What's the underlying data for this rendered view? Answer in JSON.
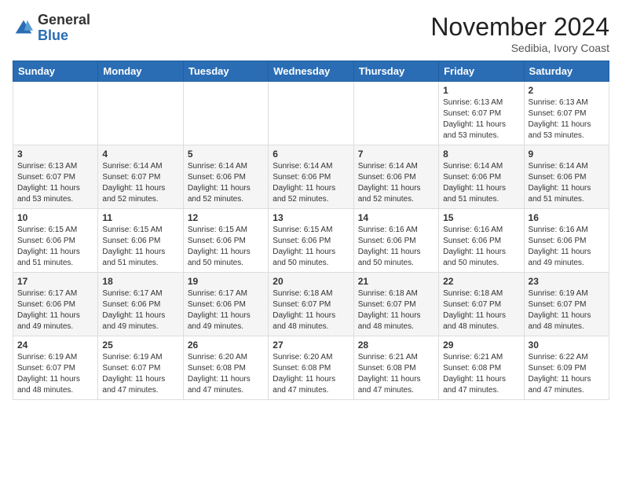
{
  "header": {
    "logo": {
      "general": "General",
      "blue": "Blue"
    },
    "title": "November 2024",
    "location": "Sedibia, Ivory Coast"
  },
  "calendar": {
    "weekdays": [
      "Sunday",
      "Monday",
      "Tuesday",
      "Wednesday",
      "Thursday",
      "Friday",
      "Saturday"
    ],
    "weeks": [
      [
        {
          "day": "",
          "info": ""
        },
        {
          "day": "",
          "info": ""
        },
        {
          "day": "",
          "info": ""
        },
        {
          "day": "",
          "info": ""
        },
        {
          "day": "",
          "info": ""
        },
        {
          "day": "1",
          "info": "Sunrise: 6:13 AM\nSunset: 6:07 PM\nDaylight: 11 hours\nand 53 minutes."
        },
        {
          "day": "2",
          "info": "Sunrise: 6:13 AM\nSunset: 6:07 PM\nDaylight: 11 hours\nand 53 minutes."
        }
      ],
      [
        {
          "day": "3",
          "info": "Sunrise: 6:13 AM\nSunset: 6:07 PM\nDaylight: 11 hours\nand 53 minutes."
        },
        {
          "day": "4",
          "info": "Sunrise: 6:14 AM\nSunset: 6:07 PM\nDaylight: 11 hours\nand 52 minutes."
        },
        {
          "day": "5",
          "info": "Sunrise: 6:14 AM\nSunset: 6:06 PM\nDaylight: 11 hours\nand 52 minutes."
        },
        {
          "day": "6",
          "info": "Sunrise: 6:14 AM\nSunset: 6:06 PM\nDaylight: 11 hours\nand 52 minutes."
        },
        {
          "day": "7",
          "info": "Sunrise: 6:14 AM\nSunset: 6:06 PM\nDaylight: 11 hours\nand 52 minutes."
        },
        {
          "day": "8",
          "info": "Sunrise: 6:14 AM\nSunset: 6:06 PM\nDaylight: 11 hours\nand 51 minutes."
        },
        {
          "day": "9",
          "info": "Sunrise: 6:14 AM\nSunset: 6:06 PM\nDaylight: 11 hours\nand 51 minutes."
        }
      ],
      [
        {
          "day": "10",
          "info": "Sunrise: 6:15 AM\nSunset: 6:06 PM\nDaylight: 11 hours\nand 51 minutes."
        },
        {
          "day": "11",
          "info": "Sunrise: 6:15 AM\nSunset: 6:06 PM\nDaylight: 11 hours\nand 51 minutes."
        },
        {
          "day": "12",
          "info": "Sunrise: 6:15 AM\nSunset: 6:06 PM\nDaylight: 11 hours\nand 50 minutes."
        },
        {
          "day": "13",
          "info": "Sunrise: 6:15 AM\nSunset: 6:06 PM\nDaylight: 11 hours\nand 50 minutes."
        },
        {
          "day": "14",
          "info": "Sunrise: 6:16 AM\nSunset: 6:06 PM\nDaylight: 11 hours\nand 50 minutes."
        },
        {
          "day": "15",
          "info": "Sunrise: 6:16 AM\nSunset: 6:06 PM\nDaylight: 11 hours\nand 50 minutes."
        },
        {
          "day": "16",
          "info": "Sunrise: 6:16 AM\nSunset: 6:06 PM\nDaylight: 11 hours\nand 49 minutes."
        }
      ],
      [
        {
          "day": "17",
          "info": "Sunrise: 6:17 AM\nSunset: 6:06 PM\nDaylight: 11 hours\nand 49 minutes."
        },
        {
          "day": "18",
          "info": "Sunrise: 6:17 AM\nSunset: 6:06 PM\nDaylight: 11 hours\nand 49 minutes."
        },
        {
          "day": "19",
          "info": "Sunrise: 6:17 AM\nSunset: 6:06 PM\nDaylight: 11 hours\nand 49 minutes."
        },
        {
          "day": "20",
          "info": "Sunrise: 6:18 AM\nSunset: 6:07 PM\nDaylight: 11 hours\nand 48 minutes."
        },
        {
          "day": "21",
          "info": "Sunrise: 6:18 AM\nSunset: 6:07 PM\nDaylight: 11 hours\nand 48 minutes."
        },
        {
          "day": "22",
          "info": "Sunrise: 6:18 AM\nSunset: 6:07 PM\nDaylight: 11 hours\nand 48 minutes."
        },
        {
          "day": "23",
          "info": "Sunrise: 6:19 AM\nSunset: 6:07 PM\nDaylight: 11 hours\nand 48 minutes."
        }
      ],
      [
        {
          "day": "24",
          "info": "Sunrise: 6:19 AM\nSunset: 6:07 PM\nDaylight: 11 hours\nand 48 minutes."
        },
        {
          "day": "25",
          "info": "Sunrise: 6:19 AM\nSunset: 6:07 PM\nDaylight: 11 hours\nand 47 minutes."
        },
        {
          "day": "26",
          "info": "Sunrise: 6:20 AM\nSunset: 6:08 PM\nDaylight: 11 hours\nand 47 minutes."
        },
        {
          "day": "27",
          "info": "Sunrise: 6:20 AM\nSunset: 6:08 PM\nDaylight: 11 hours\nand 47 minutes."
        },
        {
          "day": "28",
          "info": "Sunrise: 6:21 AM\nSunset: 6:08 PM\nDaylight: 11 hours\nand 47 minutes."
        },
        {
          "day": "29",
          "info": "Sunrise: 6:21 AM\nSunset: 6:08 PM\nDaylight: 11 hours\nand 47 minutes."
        },
        {
          "day": "30",
          "info": "Sunrise: 6:22 AM\nSunset: 6:09 PM\nDaylight: 11 hours\nand 47 minutes."
        }
      ]
    ]
  }
}
